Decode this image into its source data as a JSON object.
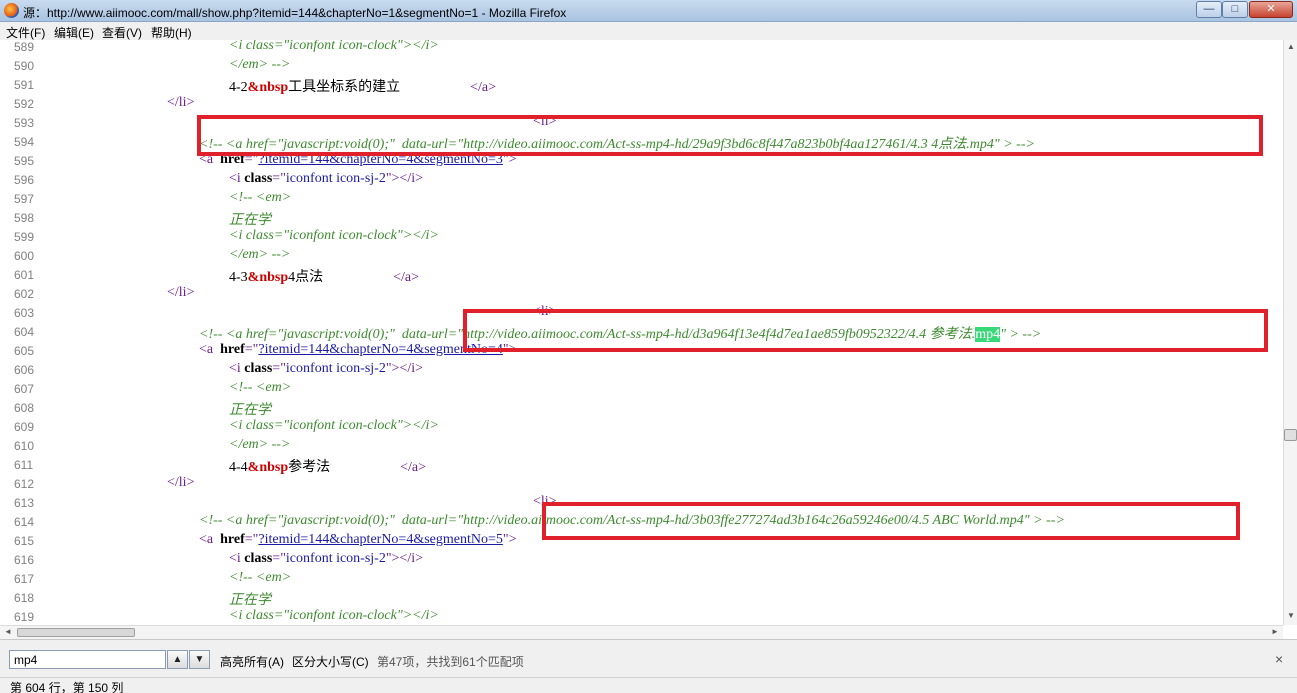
{
  "window": {
    "title": "源：http://www.aiimooc.com/mall/show.php?itemid=144&chapterNo=1&segmentNo=1 - Mozilla Firefox",
    "min_glyph": "—",
    "max_glyph": "□",
    "close_glyph": "✕"
  },
  "menu": [
    "文件(F)",
    "编辑(E)",
    "查看(V)",
    "帮助(H)"
  ],
  "source_lines": [
    {
      "n": "589",
      "indent": 229,
      "parts": [
        [
          "tag",
          "<"
        ],
        [
          "tag",
          "i "
        ],
        [
          "attr",
          "class"
        ],
        [
          "tag",
          "=\""
        ],
        [
          "cmtv",
          "iconfont icon-clock"
        ],
        [
          "tag",
          "\"></i>"
        ]
      ],
      "style": "comment"
    },
    {
      "n": "590",
      "indent": 229,
      "parts": [
        [
          "cmt",
          "</em> -->"
        ]
      ]
    },
    {
      "n": "591",
      "indent": 229,
      "parts": [
        [
          "txt",
          "4-2"
        ],
        [
          "ent",
          "&nbsp"
        ],
        [
          "txt",
          "工具坐标系的建立                    "
        ],
        [
          "tag",
          "</a>"
        ]
      ]
    },
    {
      "n": "592",
      "indent": 167,
      "parts": [
        [
          "tag",
          "</li>"
        ]
      ]
    },
    {
      "n": "593",
      "indent": 533,
      "parts": [
        [
          "tag",
          "<li>"
        ]
      ]
    },
    {
      "n": "594",
      "indent": 199,
      "parts": [
        [
          "cmt",
          "<!-- <a href=\"javascript:void(0);\"  data-url=\"http://video.aiimooc.com/Act-ss-mp4-hd/29a9f3bd6c8f447a823b0bf4aa127461/4.3 4点法.mp4\" > -->"
        ]
      ]
    },
    {
      "n": "595",
      "indent": 199,
      "parts": [
        [
          "tag",
          "<a  "
        ],
        [
          "attr",
          "href"
        ],
        [
          "tag",
          "=\""
        ],
        [
          "link",
          "?itemid=144&chapterNo=4&segmentNo=3"
        ],
        [
          "tag",
          "\">"
        ]
      ]
    },
    {
      "n": "596",
      "indent": 229,
      "parts": [
        [
          "tag",
          "<i "
        ],
        [
          "attr",
          "class"
        ],
        [
          "tag",
          "=\""
        ],
        [
          "val",
          "iconfont icon-sj-2"
        ],
        [
          "tag",
          "\"></i>"
        ]
      ]
    },
    {
      "n": "597",
      "indent": 229,
      "parts": [
        [
          "cmt",
          "<!-- <em>"
        ]
      ]
    },
    {
      "n": "598",
      "indent": 229,
      "parts": [
        [
          "cmt",
          "正在学"
        ]
      ]
    },
    {
      "n": "599",
      "indent": 229,
      "parts": [
        [
          "cmt",
          "<i class=\"iconfont icon-clock\"></i>"
        ]
      ]
    },
    {
      "n": "600",
      "indent": 229,
      "parts": [
        [
          "cmt",
          "</em> -->"
        ]
      ]
    },
    {
      "n": "601",
      "indent": 229,
      "parts": [
        [
          "txt",
          "4-3"
        ],
        [
          "ent",
          "&nbsp"
        ],
        [
          "txt",
          "4点法                    "
        ],
        [
          "tag",
          "</a>"
        ]
      ]
    },
    {
      "n": "602",
      "indent": 167,
      "parts": [
        [
          "tag",
          "</li>"
        ]
      ]
    },
    {
      "n": "603",
      "indent": 533,
      "parts": [
        [
          "tag",
          "<li>"
        ]
      ]
    },
    {
      "n": "604",
      "indent": 199,
      "parts": [
        [
          "cmt",
          "<!-- <a href=\"javascript:void(0);\"  data-url=\"http://video.aiimooc.com/Act-ss-mp4-hd/d3a964f13e4f4d7ea1ae859fb0952322/4.4 参考法."
        ],
        [
          "hl",
          "mp4"
        ],
        [
          "cmt",
          "\" > -->"
        ]
      ]
    },
    {
      "n": "605",
      "indent": 199,
      "parts": [
        [
          "tag",
          "<a  "
        ],
        [
          "attr",
          "href"
        ],
        [
          "tag",
          "=\""
        ],
        [
          "link",
          "?itemid=144&chapterNo=4&segmentNo=4"
        ],
        [
          "tag",
          "\">"
        ]
      ]
    },
    {
      "n": "606",
      "indent": 229,
      "parts": [
        [
          "tag",
          "<i "
        ],
        [
          "attr",
          "class"
        ],
        [
          "tag",
          "=\""
        ],
        [
          "val",
          "iconfont icon-sj-2"
        ],
        [
          "tag",
          "\"></i>"
        ]
      ]
    },
    {
      "n": "607",
      "indent": 229,
      "parts": [
        [
          "cmt",
          "<!-- <em>"
        ]
      ]
    },
    {
      "n": "608",
      "indent": 229,
      "parts": [
        [
          "cmt",
          "正在学"
        ]
      ]
    },
    {
      "n": "609",
      "indent": 229,
      "parts": [
        [
          "cmt",
          "<i class=\"iconfont icon-clock\"></i>"
        ]
      ]
    },
    {
      "n": "610",
      "indent": 229,
      "parts": [
        [
          "cmt",
          "</em> -->"
        ]
      ]
    },
    {
      "n": "611",
      "indent": 229,
      "parts": [
        [
          "txt",
          "4-4"
        ],
        [
          "ent",
          "&nbsp"
        ],
        [
          "txt",
          "参考法                    "
        ],
        [
          "tag",
          "</a>"
        ]
      ]
    },
    {
      "n": "612",
      "indent": 167,
      "parts": [
        [
          "tag",
          "</li>"
        ]
      ]
    },
    {
      "n": "613",
      "indent": 533,
      "parts": [
        [
          "tag",
          "<li>"
        ]
      ]
    },
    {
      "n": "614",
      "indent": 199,
      "parts": [
        [
          "cmt",
          "<!-- <a href=\"javascript:void(0);\"  data-url=\"http://video.aiimooc.com/Act-ss-mp4-hd/3b03ffe277274ad3b164c26a59246e00/4.5 ABC World.mp4\" > -->"
        ]
      ]
    },
    {
      "n": "615",
      "indent": 199,
      "parts": [
        [
          "tag",
          "<a  "
        ],
        [
          "attr",
          "href"
        ],
        [
          "tag",
          "=\""
        ],
        [
          "link",
          "?itemid=144&chapterNo=4&segmentNo=5"
        ],
        [
          "tag",
          "\">"
        ]
      ]
    },
    {
      "n": "616",
      "indent": 229,
      "parts": [
        [
          "tag",
          "<i "
        ],
        [
          "attr",
          "class"
        ],
        [
          "tag",
          "=\""
        ],
        [
          "val",
          "iconfont icon-sj-2"
        ],
        [
          "tag",
          "\"></i>"
        ]
      ]
    },
    {
      "n": "617",
      "indent": 229,
      "parts": [
        [
          "cmt",
          "<!-- <em>"
        ]
      ]
    },
    {
      "n": "618",
      "indent": 229,
      "parts": [
        [
          "cmt",
          "正在学"
        ]
      ]
    },
    {
      "n": "619",
      "indent": 229,
      "parts": [
        [
          "cmt",
          "<i class=\"iconfont icon-clock\"></i>"
        ]
      ]
    }
  ],
  "find": {
    "value": "mp4",
    "prev_glyph": "▲",
    "next_glyph": "▼",
    "highlight_all": "高亮所有(A)",
    "match_case": "区分大小写(C)",
    "status": "第47项，共找到61个匹配项",
    "close_glyph": "×"
  },
  "status": {
    "position": "第 604 行，第 150 列"
  },
  "scroll": {
    "up": "▲",
    "down": "▼",
    "left": "◄",
    "right": "►",
    "grip": "≡",
    "hgrip": "III"
  },
  "colors": {
    "highlight_box": "#e0202a",
    "find_match": "#38d878"
  }
}
